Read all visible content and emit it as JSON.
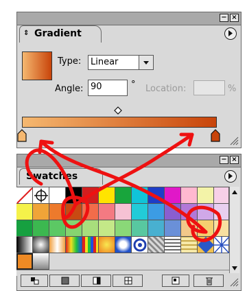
{
  "gradient_panel": {
    "tab_label": "Gradient",
    "type_label": "Type:",
    "type_value": "Linear",
    "angle_label": "Angle:",
    "angle_value": "90",
    "degree_symbol": "°",
    "location_label": "Location:",
    "location_value": "",
    "percent_symbol": "%",
    "start_color": "#f5b870",
    "end_color": "#c8440a"
  },
  "swatches_panel": {
    "tab_label": "Swatches"
  },
  "window_controls": {
    "minimize_glyph": "−",
    "close_glyph": "×",
    "menu_glyph": "▶"
  },
  "colors": {
    "panel_bg": "#d9d9d9",
    "titlebar_bg": "#a9a9a9",
    "annotation_red": "#ee1111"
  },
  "icons": [
    "gradient-preview-icon",
    "dropdown-arrow-icon",
    "midpoint-diamond-icon",
    "gradient-stop-icon",
    "panel-menu-icon",
    "resize-grip-icon",
    "show-swatches-icon",
    "new-swatch-icon",
    "delete-swatch-icon"
  ]
}
